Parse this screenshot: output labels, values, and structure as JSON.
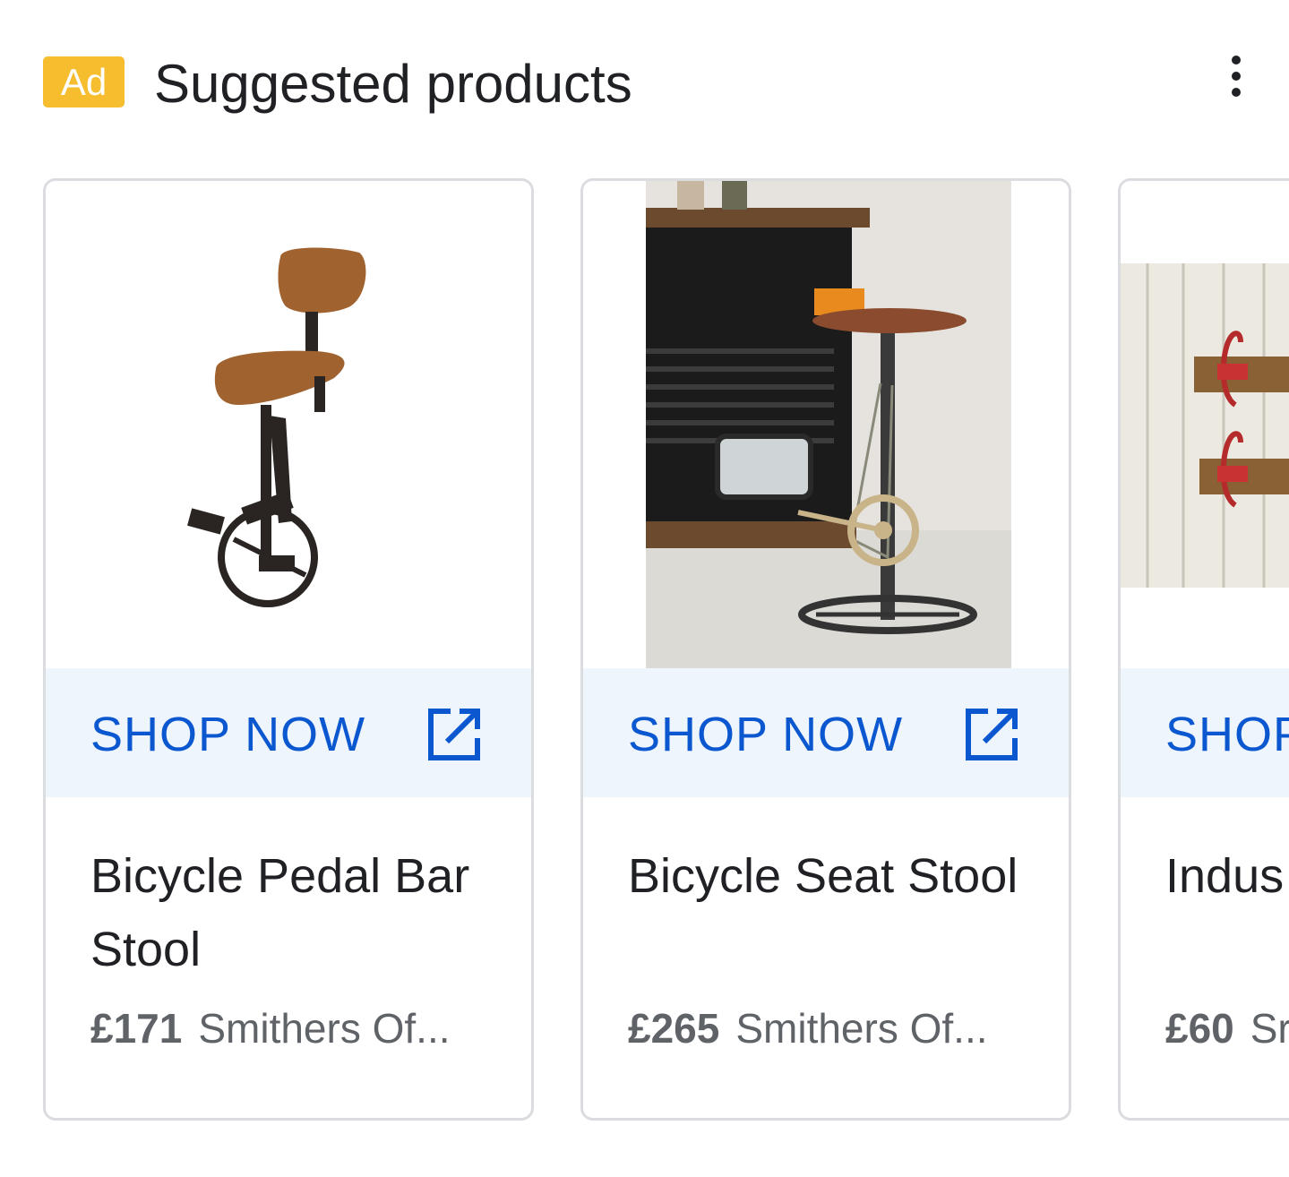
{
  "header": {
    "ad_label": "Ad",
    "title": "Suggested products",
    "more_icon": "more-vert-icon"
  },
  "colors": {
    "ad_badge": "#f6be2e",
    "cta_text": "#0b57d0",
    "cta_background": "#eef5fd",
    "card_border": "#dadce0"
  },
  "products": [
    {
      "cta_label": "SHOP NOW",
      "cta_icon": "open-in-new-icon",
      "name": "Bicycle Pedal Bar Stool",
      "price": "£171",
      "merchant": "Smithers Of..."
    },
    {
      "cta_label": "SHOP NOW",
      "cta_icon": "open-in-new-icon",
      "name": "Bicycle Seat Stool",
      "price": "£265",
      "merchant": "Smithers Of..."
    },
    {
      "cta_label": "SHOP",
      "cta_icon": "open-in-new-icon",
      "name": "Indus Peg",
      "price": "£60",
      "merchant": "Sr"
    }
  ]
}
